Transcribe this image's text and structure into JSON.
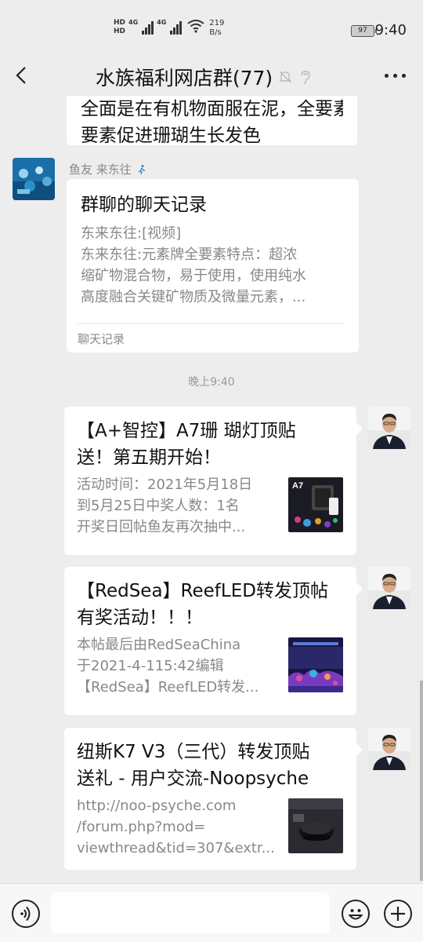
{
  "status_bar": {
    "hd1": "HD",
    "hd2": "HD",
    "net1": "4G",
    "net2": "4G",
    "speed_value": "219",
    "speed_unit": "B/s",
    "battery": "97",
    "time": "9:40"
  },
  "nav": {
    "title": "水族福利网店群(77)"
  },
  "messages": {
    "partial_text": "全面是在有机物面服在泥，全要素促进珊瑚生长发色",
    "partial_line2": "要素促进珊瑚生长发色",
    "sender_name": "鱼友 来东往",
    "chat_record": {
      "title": "群聊的聊天记录",
      "lines": [
        "东来东往:[视频]",
        "东来东往:元素牌全要素特点：超浓",
        "缩矿物混合物，易于使用，使用纯水",
        "高度融合关键矿物质及微量元素，..."
      ],
      "footer": "聊天记录"
    },
    "time_label": "晚上9:40",
    "cards": [
      {
        "title_line1": "【A+智控】A7珊 瑚灯顶贴",
        "title_line2": "送！第五期开始！",
        "desc": [
          "活动时间：2021年5月18日",
          "到5月25日中奖人数：1名",
          "开奖日回帖鱼友再次抽中..."
        ],
        "thumb_label": "A7"
      },
      {
        "title_line1": "【RedSea】ReefLED转发顶帖",
        "title_line2": "有奖活动！！！",
        "desc": [
          "本帖最后由RedSeaChina",
          "于2021-4-115:42编辑",
          "【RedSea】ReefLED转发..."
        ]
      },
      {
        "title_line1": "纽斯K7 V3（三代）转发顶贴",
        "title_line2": "送礼 - 用户交流-Noopsyche",
        "desc": [
          "http://noo-psyche.com",
          "/forum.php?mod=",
          "viewthread&tid=307&extr..."
        ]
      }
    ]
  },
  "colors": {
    "background": "#ededed",
    "bubble": "#ffffff",
    "secondary_text": "#888888"
  }
}
